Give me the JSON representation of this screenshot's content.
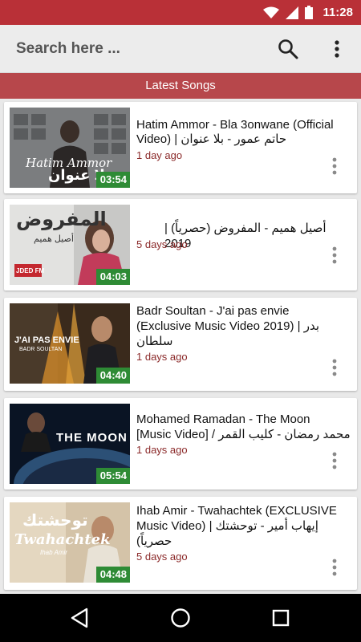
{
  "status_bar": {
    "time": "11:28"
  },
  "app_bar": {
    "search_placeholder": "Search here ..."
  },
  "section": {
    "title": "Latest Songs"
  },
  "songs": [
    {
      "title": "Hatim Ammor - Bla 3onwane (Official Video) | حاتم عمور - بلا عنوان",
      "line1": "Hatim Ammor - Bla 3onwane (Official",
      "line2": "Video) | حاتم عمور - بلا عنوان",
      "date": "1 day ago",
      "duration": "03:54",
      "thumb_text": "بلا عنوان",
      "thumb_script": "Hatim Ammor"
    },
    {
      "title": "أصيل هميم - المفروض (حصرياً) | 2019",
      "line1": "أصيل هميم - المفروض (حصرياً) | 2019",
      "date": "5 days ago",
      "duration": "04:03",
      "thumb_text": "المفروض",
      "thumb_sub": "أصيل هميم",
      "thumb_badge": "JDED FM"
    },
    {
      "title": "Badr Soultan - J'ai pas envie (Exclusive Music Video 2019) | بدر سلطان",
      "line1": "Badr Soultan - J'ai pas envie",
      "line2": "(Exclusive Music Video 2019) | بدر",
      "line3": "سلطان",
      "date": "1 days ago",
      "duration": "04:40",
      "thumb_text": "J'AI PAS ENVIE",
      "thumb_sub": "BADR SOULTAN"
    },
    {
      "title": "Mohamed Ramadan - The Moon [Music Video] / محمد رمضان - كليب القمر",
      "line1": "Mohamed Ramadan - The Moon",
      "line2": "[Music Video] / محمد رمضان - كليب القمر",
      "date": "1 days ago",
      "duration": "05:54",
      "thumb_text": "THE MOON"
    },
    {
      "title": "Ihab Amir - Twahachtek (EXCLUSIVE Music Video) | إيهاب أمير - توحشتك (حصرياً)",
      "line1": "Ihab Amir - Twahachtek (EXCLUSIVE",
      "line2": "Music Video) | إيهاب أمير - توحشتك",
      "line3": "(حصرياً",
      "date": "5 days ago",
      "duration": "04:48",
      "thumb_text": "توحشتك",
      "thumb_script": "Twahachtek",
      "thumb_sub": "Ihab Amir"
    }
  ],
  "colors": {
    "status_bar": "#b93037",
    "section_header": "#b7474b",
    "duration_badge": "#2e8b35",
    "date_text": "#8b2a2a"
  },
  "icons": {
    "status": [
      "wifi-icon",
      "signal-icon",
      "battery-icon"
    ],
    "app_bar": [
      "search-icon",
      "more-vert-icon"
    ],
    "nav": [
      "back-icon",
      "home-icon",
      "recents-icon"
    ]
  }
}
